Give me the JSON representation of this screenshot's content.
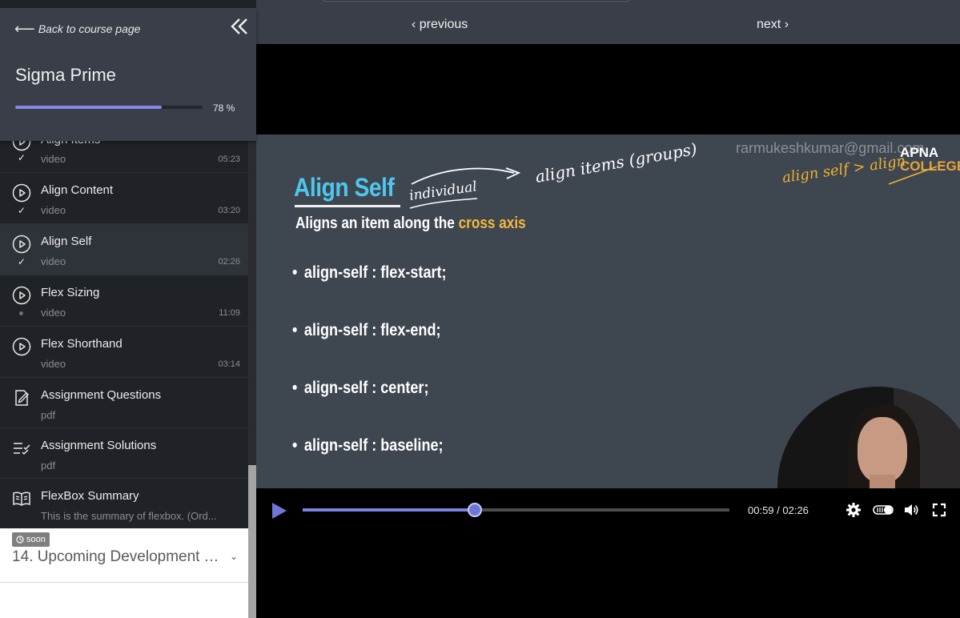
{
  "sidebar": {
    "back_label": "Back to course page",
    "course_title": "Sigma Prime",
    "progress_percent": 78,
    "progress_label": "78 %",
    "items": [
      {
        "title": "Align Items",
        "type": "video",
        "duration": "05:23",
        "status": "done",
        "icon": "play-circle-icon"
      },
      {
        "title": "Align Content",
        "type": "video",
        "duration": "03:20",
        "status": "done",
        "icon": "play-circle-icon"
      },
      {
        "title": "Align Self",
        "type": "video",
        "duration": "02:26",
        "status": "done",
        "icon": "play-circle-icon"
      },
      {
        "title": "Flex Sizing",
        "type": "video",
        "duration": "11:09",
        "status": "pending",
        "icon": "play-circle-icon"
      },
      {
        "title": "Flex Shorthand",
        "type": "video",
        "duration": "03:14",
        "status": "none",
        "icon": "play-circle-icon"
      },
      {
        "title": "Assignment Questions",
        "type": "pdf",
        "duration": "",
        "status": "none",
        "icon": "edit-note-icon"
      },
      {
        "title": "Assignment Solutions",
        "type": "pdf",
        "duration": "",
        "status": "none",
        "icon": "checklist-icon"
      },
      {
        "title": "FlexBox Summary",
        "type": "This is the summary of flexbox. (Ord...",
        "duration": "",
        "status": "none",
        "icon": "book-icon"
      }
    ],
    "upcoming": {
      "badge": "soon",
      "title": "14. Upcoming Development T..."
    }
  },
  "topbar": {
    "previous_label": "‹ previous",
    "next_label": "next ›"
  },
  "slide": {
    "title": "Align Self",
    "subtitle_prefix": "Aligns an item along the ",
    "subtitle_highlight": "cross axis",
    "bullets": [
      "align-self : flex-start;",
      "align-self : flex-end;",
      "align-self : center;",
      "align-self : baseline;"
    ],
    "watermark": "rarmukeshkumar@gmail.com",
    "logo_top": "APNA",
    "logo_bottom": "COLLEGE",
    "handwriting": {
      "note1": "individual",
      "note2": "align items (groups)",
      "note3": "align self > align"
    }
  },
  "player": {
    "time_label": "00:59 / 02:26",
    "progress_fraction": 0.404,
    "accent": "#7d84e0"
  },
  "colors": {
    "sidebar_bg": "#1f2226",
    "header_bg": "#393e48",
    "slide_bg": "#3e4650",
    "slide_title": "#4fc7ec",
    "highlight": "#f5b940"
  }
}
